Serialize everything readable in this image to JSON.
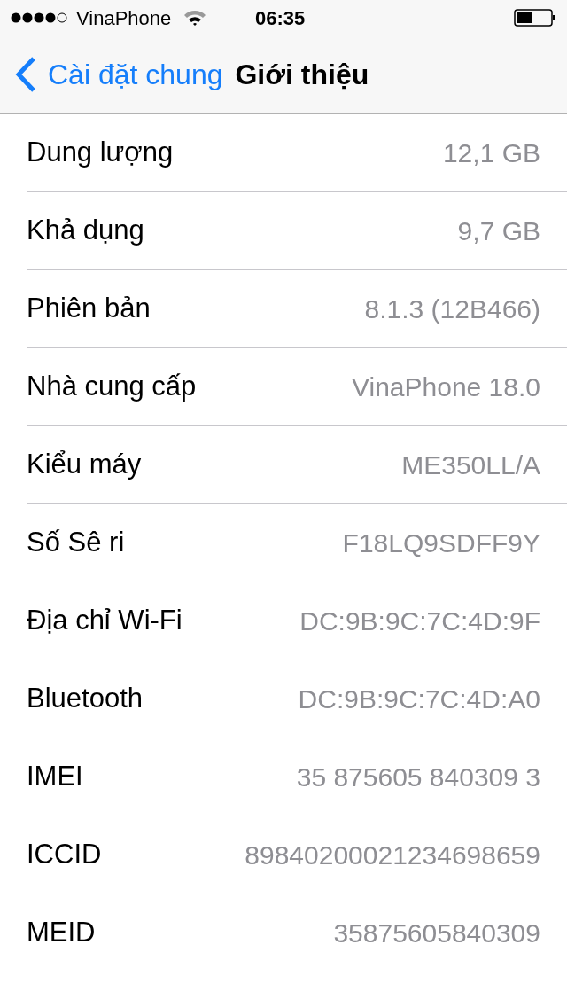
{
  "status_bar": {
    "carrier": "VinaPhone",
    "time": "06:35"
  },
  "nav": {
    "back": "Cài đặt chung",
    "title": "Giới thiệu"
  },
  "rows": [
    {
      "label": "Dung lượng",
      "value": "12,1 GB"
    },
    {
      "label": "Khả dụng",
      "value": "9,7 GB"
    },
    {
      "label": "Phiên bản",
      "value": "8.1.3 (12B466)"
    },
    {
      "label": "Nhà cung cấp",
      "value": "VinaPhone 18.0"
    },
    {
      "label": "Kiểu máy",
      "value": "ME350LL/A"
    },
    {
      "label": "Số Sê ri",
      "value": "F18LQ9SDFF9Y"
    },
    {
      "label": "Địa chỉ Wi-Fi",
      "value": "DC:9B:9C:7C:4D:9F"
    },
    {
      "label": "Bluetooth",
      "value": "DC:9B:9C:7C:4D:A0"
    },
    {
      "label": "IMEI",
      "value": "35 875605 840309 3"
    },
    {
      "label": "ICCID",
      "value": "89840200021234698659"
    },
    {
      "label": "MEID",
      "value": "35875605840309"
    }
  ]
}
